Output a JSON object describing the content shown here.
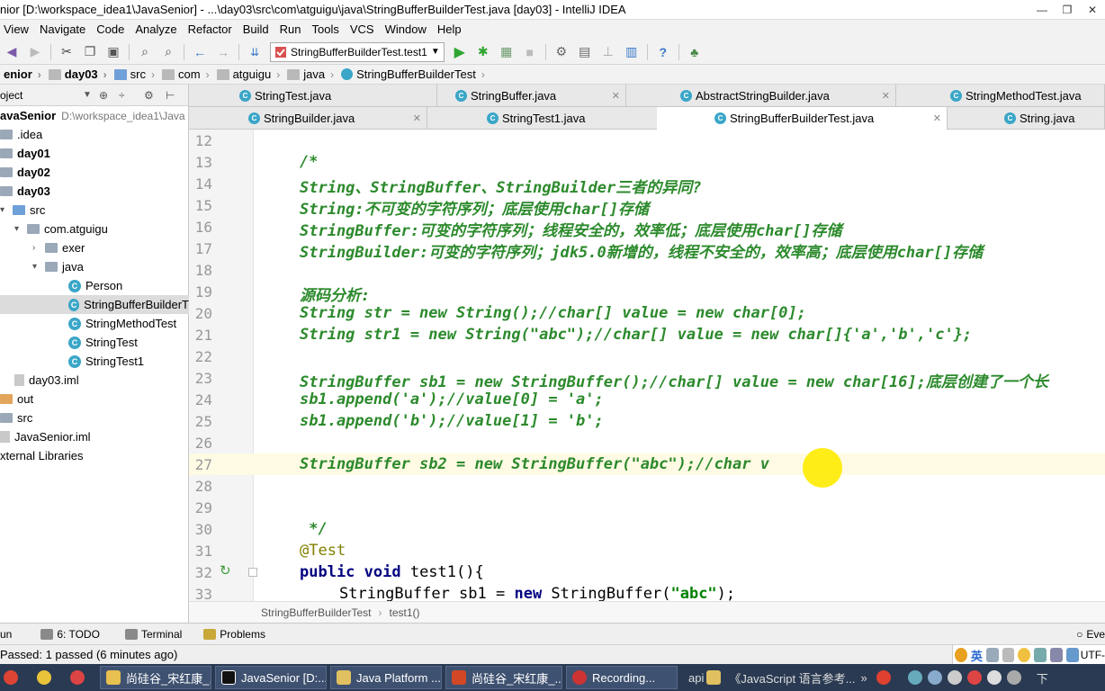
{
  "window": {
    "title": "nior [D:\\workspace_idea1\\JavaSenior] - ...\\day03\\src\\com\\atguigu\\java\\StringBufferBuilderTest.java [day03] - IntelliJ IDEA",
    "controls": [
      "—",
      "❐",
      "✕"
    ]
  },
  "menu": [
    "View",
    "Navigate",
    "Code",
    "Analyze",
    "Refactor",
    "Build",
    "Run",
    "Tools",
    "VCS",
    "Window",
    "Help"
  ],
  "toolbar": {
    "run_config": "StringBufferBuilderTest.test1"
  },
  "navbar": {
    "crumbs": [
      "enior",
      "day03",
      "src",
      "com",
      "atguigu",
      "java",
      "StringBufferBuilderTest"
    ]
  },
  "project": {
    "header_label": "oject",
    "tree": [
      {
        "text": "avaSenior",
        "extra": "D:\\workspace_idea1\\Java",
        "bold": true
      },
      {
        "text": ".idea"
      },
      {
        "text": "day01",
        "bold": true
      },
      {
        "text": "day02",
        "bold": true
      },
      {
        "text": "day03",
        "bold": true
      },
      {
        "text": "src"
      },
      {
        "text": "com.atguigu"
      },
      {
        "text": "exer"
      },
      {
        "text": "java"
      },
      {
        "text": "Person"
      },
      {
        "text": "StringBufferBuilderT"
      },
      {
        "text": "StringMethodTest"
      },
      {
        "text": "StringTest"
      },
      {
        "text": "StringTest1"
      },
      {
        "text": "day03.iml"
      },
      {
        "text": "out"
      },
      {
        "text": "src"
      },
      {
        "text": "JavaSenior.iml"
      },
      {
        "text": "xternal Libraries"
      }
    ]
  },
  "tabs": {
    "row1": [
      "StringTest.java",
      "StringBuffer.java",
      "AbstractStringBuilder.java",
      "StringMethodTest.java"
    ],
    "row2": [
      "StringBuilder.java",
      "StringTest1.java",
      "StringBufferBuilderTest.java",
      "String.java"
    ]
  },
  "editor": {
    "line_numbers": [
      "12",
      "13",
      "14",
      "15",
      "16",
      "17",
      "18",
      "19",
      "20",
      "21",
      "22",
      "23",
      "24",
      "25",
      "26",
      "27",
      "28",
      "29",
      "30",
      "31",
      "32",
      "33"
    ],
    "comment_lines": {
      "l13": "/*",
      "l14": "String、StringBuffer、StringBuilder三者的异同?",
      "l15": "String:不可变的字符序列；底层使用char[]存储",
      "l16": "StringBuffer:可变的字符序列；线程安全的，效率低；底层使用char[]存储",
      "l17": "StringBuilder:可变的字符序列；jdk5.0新增的，线程不安全的，效率高；底层使用char[]存储",
      "l19": "源码分析:",
      "l20": "String str = new String();//char[] value = new char[0];",
      "l21": "String str1 = new String(\"abc\");//char[] value = new char[]{'a','b','c'};",
      "l23": "StringBuffer sb1 = new StringBuffer();//char[] value = new char[16];底层创建了一个长",
      "l24": "sb1.append('a');//value[0] = 'a';",
      "l25": "sb1.append('b');//value[1] = 'b';",
      "l27": "StringBuffer sb2 = new StringBuffer(\"abc\");//char v",
      "l30": " */"
    },
    "l31_annotation": "@Test",
    "l32": {
      "kw": "public void",
      "rest": " test1(){"
    },
    "l33": {
      "type": "StringBuffer sb1 = ",
      "kw": "new",
      "mid": " StringBuffer(",
      "str": "\"abc\"",
      "end": ");"
    }
  },
  "editor_crumb": [
    "StringBufferBuilderTest",
    "test1()"
  ],
  "toolwindows": [
    "un",
    "6: TODO",
    "Terminal",
    "Problems",
    "Eve"
  ],
  "status": {
    "text": "Passed: 1 passed (6 minutes ago)",
    "ime_label": "英",
    "ime_tail": "UTF-"
  },
  "taskbar": {
    "tasks": [
      "尚硅谷_宋红康_...",
      "JavaSenior [D:...",
      "Java Platform ...",
      "尚硅谷_宋红康_...",
      "Recording..."
    ],
    "tray_text": "api",
    "tray_doc": "《JavaScript 语言参考...",
    "tray_more": "»",
    "tail": "下"
  },
  "colors": {
    "comment": "#2c8a2c",
    "keyword": "#000080",
    "annotation": "#808000",
    "current_line": "#fffae3",
    "taskbar": "#2a3a52",
    "cursor_highlight": "#ffeb00"
  }
}
